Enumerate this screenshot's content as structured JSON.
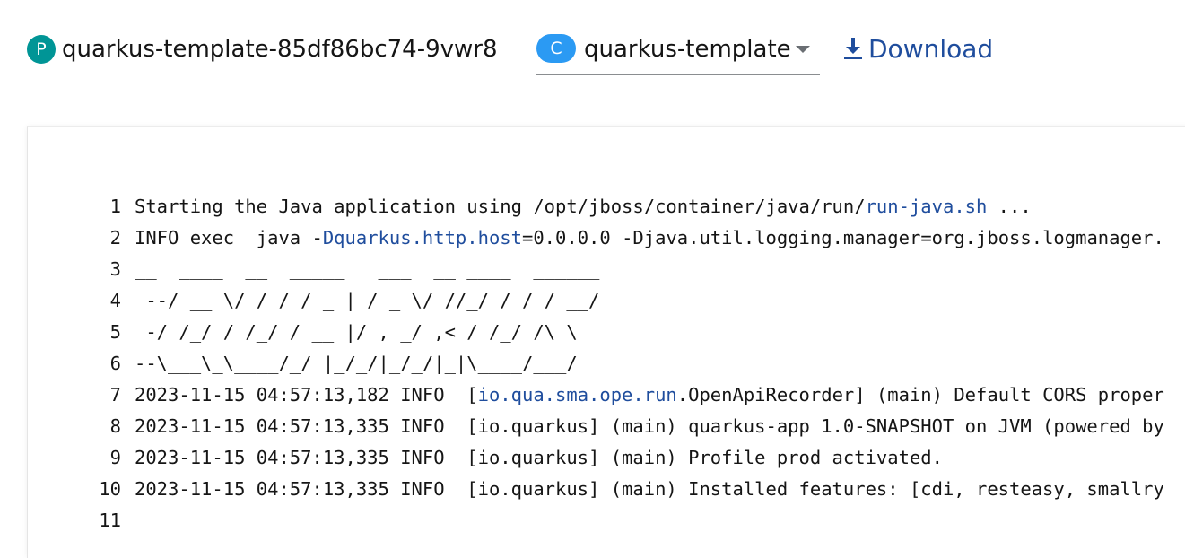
{
  "toolbar": {
    "pod": {
      "badge": "P",
      "name": "quarkus-template-85df86bc74-9vwr8",
      "badge_color": "#009596"
    },
    "container_select": {
      "badge": "C",
      "selected": "quarkus-template",
      "badge_color": "#2b9af3",
      "caret_icon": "caret-down-icon"
    },
    "download": {
      "label": "Download",
      "icon": "download-icon",
      "color": "#1f4d9d"
    }
  },
  "log": {
    "lines": [
      {
        "no": "1",
        "parts": [
          {
            "text": "Starting the Java application using /opt/jboss/container/java/run/"
          },
          {
            "text": "run-java.sh",
            "link": true
          },
          {
            "text": " ..."
          }
        ]
      },
      {
        "no": "2",
        "parts": [
          {
            "text": "INFO exec  java -"
          },
          {
            "text": "Dquarkus.http.host",
            "link": true
          },
          {
            "text": "=0.0.0.0 -Djava.util.logging.manager=org.jboss.logmanager."
          }
        ]
      },
      {
        "no": "3",
        "parts": [
          {
            "text": "__  ____  __  _____   ___  __ ____  ______"
          }
        ]
      },
      {
        "no": "4",
        "parts": [
          {
            "text": " --/ __ \\/ / / / _ | / _ \\/ //_/ / / / __/"
          }
        ]
      },
      {
        "no": "5",
        "parts": [
          {
            "text": " -/ /_/ / /_/ / __ |/ , _/ ,< / /_/ /\\ \\"
          }
        ]
      },
      {
        "no": "6",
        "parts": [
          {
            "text": "--\\___\\_\\____/_/ |_/_/|_/_/|_|\\____/___/"
          }
        ]
      },
      {
        "no": "7",
        "parts": [
          {
            "text": "2023-11-15 04:57:13,182 INFO  ["
          },
          {
            "text": "io.qua.sma.ope.run",
            "link": true
          },
          {
            "text": ".OpenApiRecorder] (main) Default CORS proper"
          }
        ]
      },
      {
        "no": "8",
        "parts": [
          {
            "text": "2023-11-15 04:57:13,335 INFO  [io.quarkus] (main) quarkus-app 1.0-SNAPSHOT on JVM (powered by"
          }
        ]
      },
      {
        "no": "9",
        "parts": [
          {
            "text": "2023-11-15 04:57:13,335 INFO  [io.quarkus] (main) Profile prod activated."
          }
        ]
      },
      {
        "no": "10",
        "parts": [
          {
            "text": "2023-11-15 04:57:13,335 INFO  [io.quarkus] (main) Installed features: [cdi, resteasy, smallry"
          }
        ]
      },
      {
        "no": "11",
        "parts": [
          {
            "text": ""
          }
        ]
      }
    ],
    "link_color": "#1f4d9d"
  }
}
